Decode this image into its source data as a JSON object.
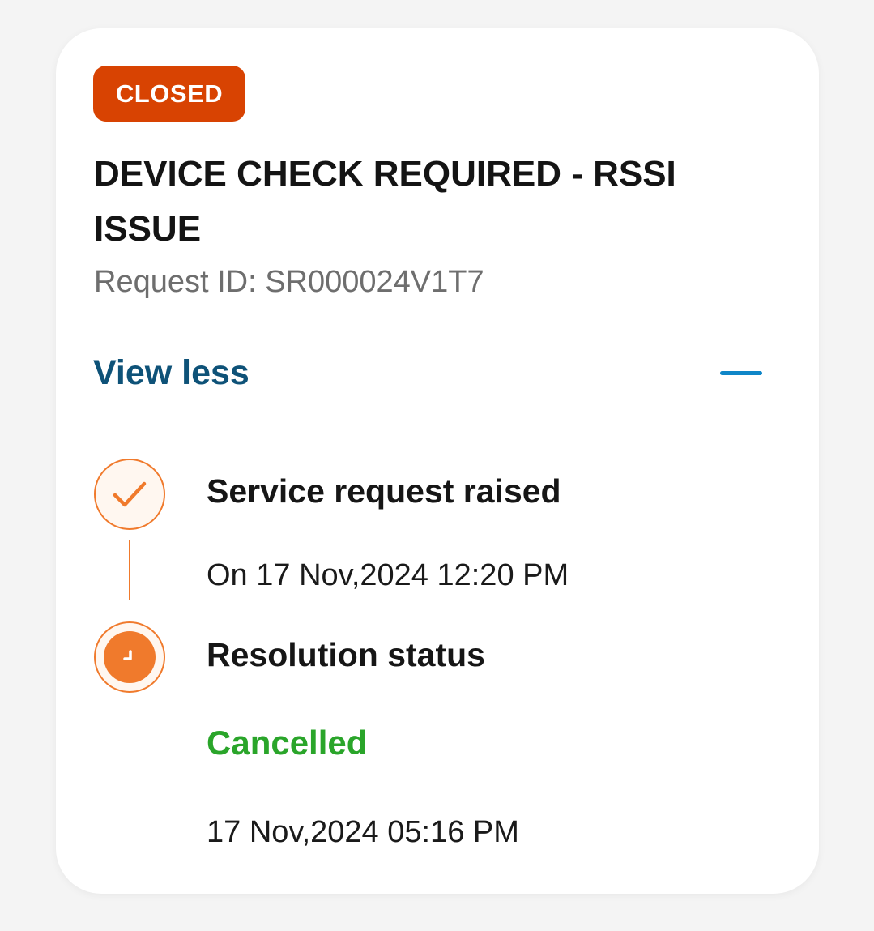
{
  "card": {
    "status_badge": "CLOSED",
    "title": "DEVICE CHECK REQUIRED - RSSI ISSUE",
    "request_id": "Request ID: SR000024V1T7",
    "toggle_label": "View less",
    "toggle_icon": "minus-icon"
  },
  "timeline": {
    "steps": [
      {
        "icon": "check-icon",
        "title": "Service request raised",
        "date": "On 17 Nov,2024 12:20 PM"
      },
      {
        "icon": "clock-icon",
        "title": "Resolution status",
        "status": "Cancelled",
        "date": "17 Nov,2024 05:16 PM"
      }
    ]
  },
  "colors": {
    "badge_bg": "#d84302",
    "accent": "#f07a2c",
    "link": "#0e5278",
    "minus": "#0f86c8",
    "status_cancelled": "#2aa52a"
  }
}
